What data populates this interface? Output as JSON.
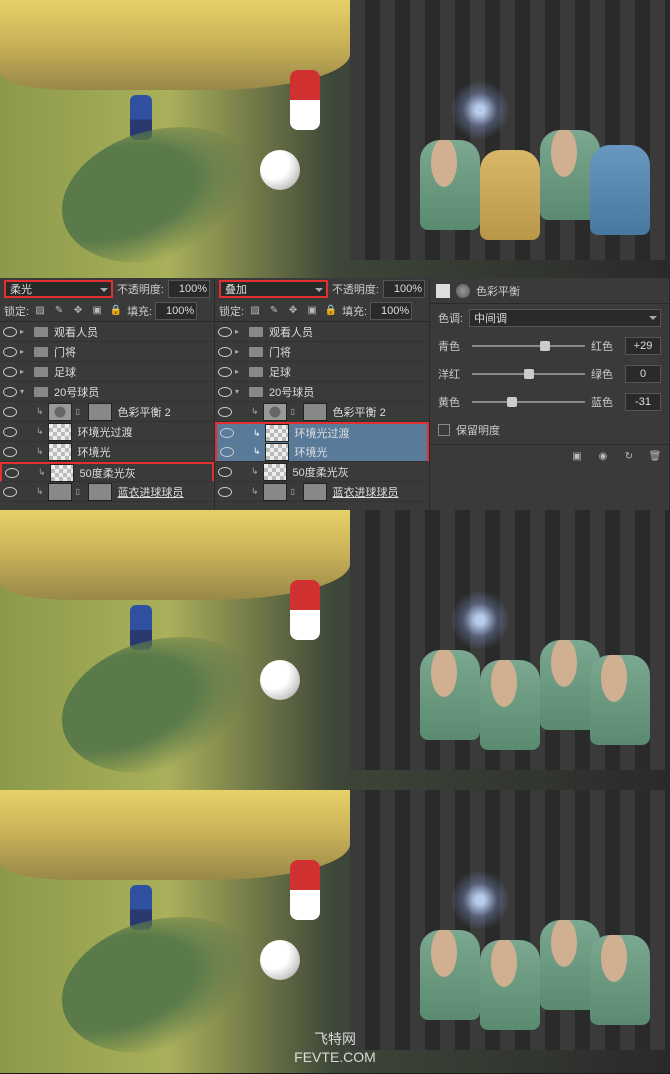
{
  "images": {
    "watermark_line1": "飞特网",
    "watermark_line2": "FEVTE.COM"
  },
  "panel_left": {
    "blend_mode": "柔光",
    "opacity_label": "不透明度:",
    "opacity_value": "100%",
    "lock_label": "锁定:",
    "fill_label": "填充:",
    "fill_value": "100%",
    "layers": [
      {
        "name": "观看人员",
        "type": "folder"
      },
      {
        "name": "门将",
        "type": "folder"
      },
      {
        "name": "足球",
        "type": "folder"
      },
      {
        "name": "20号球员",
        "type": "folder",
        "expanded": true
      },
      {
        "name": "色彩平衡 2",
        "type": "adj",
        "indent": 1
      },
      {
        "name": "环境光过渡",
        "type": "layer",
        "indent": 1
      },
      {
        "name": "环境光",
        "type": "layer",
        "indent": 1
      },
      {
        "name": "50度柔光灰",
        "type": "layer",
        "indent": 1,
        "highlighted": true
      },
      {
        "name": "蓝衣进球球员",
        "type": "layer",
        "indent": 1,
        "underline": true
      }
    ]
  },
  "panel_mid": {
    "blend_mode": "叠加",
    "opacity_label": "不透明度:",
    "opacity_value": "100%",
    "lock_label": "锁定:",
    "fill_label": "填充:",
    "fill_value": "100%",
    "layers": [
      {
        "name": "观看人员",
        "type": "folder"
      },
      {
        "name": "门将",
        "type": "folder"
      },
      {
        "name": "足球",
        "type": "folder"
      },
      {
        "name": "20号球员",
        "type": "folder",
        "expanded": true
      },
      {
        "name": "色彩平衡 2",
        "type": "adj",
        "indent": 1
      },
      {
        "name": "环境光过渡",
        "type": "layer",
        "indent": 1,
        "selected": true
      },
      {
        "name": "环境光",
        "type": "layer",
        "indent": 1,
        "selected": true,
        "highlighted": true
      },
      {
        "name": "50度柔光灰",
        "type": "layer",
        "indent": 1
      },
      {
        "name": "蓝衣进球球员",
        "type": "layer",
        "indent": 1,
        "underline": true
      }
    ]
  },
  "color_balance": {
    "title": "色彩平衡",
    "tone_label": "色调:",
    "tone_value": "中间调",
    "sliders": [
      {
        "left": "青色",
        "right": "红色",
        "value": "+29",
        "pos": 65
      },
      {
        "left": "洋红",
        "right": "绿色",
        "value": "0",
        "pos": 50
      },
      {
        "left": "黄色",
        "right": "蓝色",
        "value": "-31",
        "pos": 35
      }
    ],
    "preserve_label": "保留明度"
  }
}
